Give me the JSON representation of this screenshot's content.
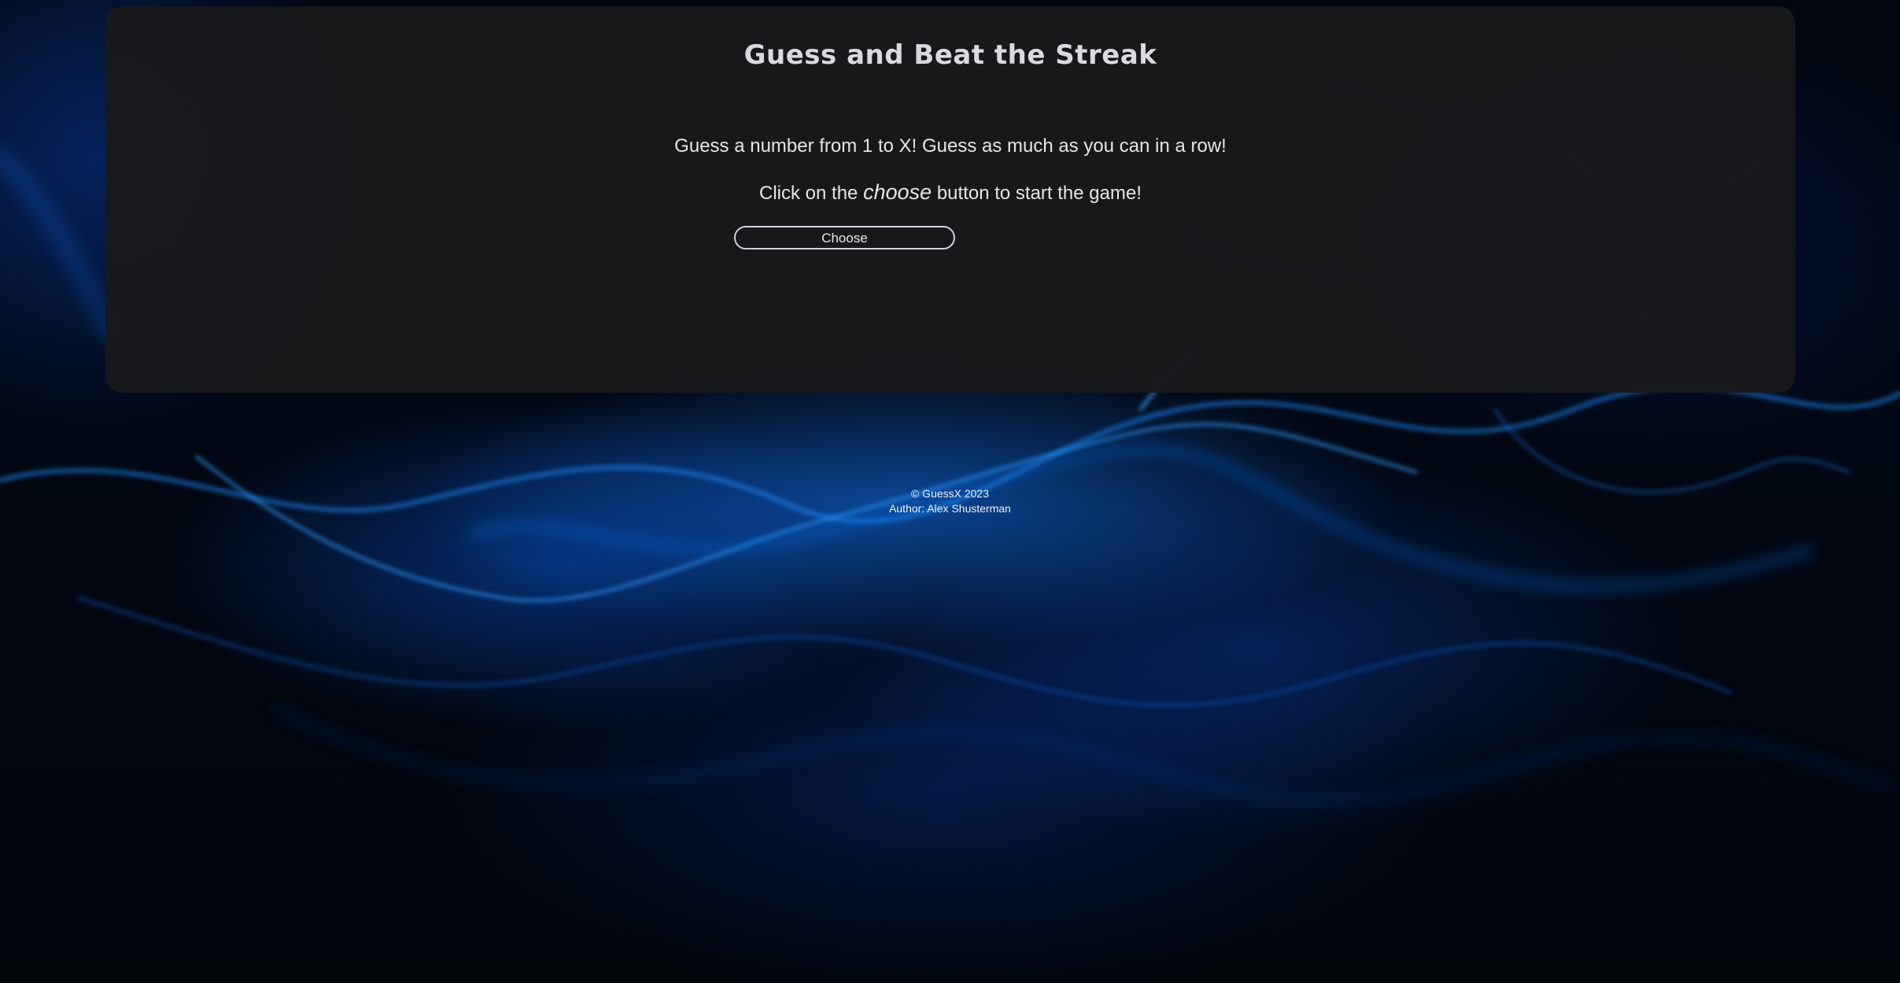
{
  "header": {
    "title": "Guess and Beat the Streak"
  },
  "instructions": {
    "line1": "Guess a number from 1 to X! Guess as much as you can in a row!",
    "line2_before": "Click on the ",
    "line2_emphasis": "choose",
    "line2_after": " button to start the game!"
  },
  "actions": {
    "choose_label": "Choose"
  },
  "footer": {
    "copyright": "© GuessX 2023",
    "author": "Author: Alex Shusterman"
  },
  "theme": {
    "panel_color": "#18191b",
    "text_color": "#e4e6e8",
    "background_accent": "#1478ff"
  }
}
